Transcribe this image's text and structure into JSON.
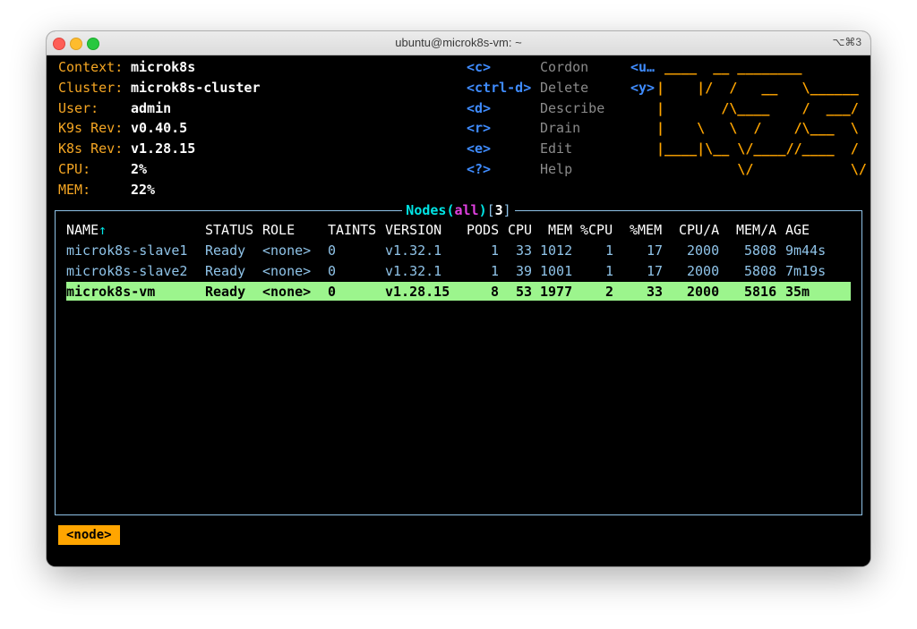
{
  "window": {
    "title": "ubuntu@microk8s-vm: ~",
    "shortcut": "⌥⌘3"
  },
  "info": [
    {
      "key": "Context:",
      "value": "microk8s"
    },
    {
      "key": "Cluster:",
      "value": "microk8s-cluster"
    },
    {
      "key": "User:",
      "value": "admin"
    },
    {
      "key": "K9s Rev:",
      "value": "v0.40.5"
    },
    {
      "key": "K8s Rev:",
      "value": "v1.28.15"
    },
    {
      "key": "CPU:",
      "value": "2%"
    },
    {
      "key": "MEM:",
      "value": "22%"
    }
  ],
  "hotkeys": [
    {
      "key": "<c>",
      "action": "Cordon"
    },
    {
      "key": "<ctrl-d>",
      "action": "Delete"
    },
    {
      "key": "<d>",
      "action": "Describe"
    },
    {
      "key": "<r>",
      "action": "Drain"
    },
    {
      "key": "<e>",
      "action": "Edit"
    },
    {
      "key": "<?>",
      "action": "Help"
    }
  ],
  "hotkeys2": [
    "<u…",
    "<y>"
  ],
  "logo": [
    " ____  __ ________",
    "|    |/  /   __   \\______",
    "|       /\\____    /  ___/",
    "|    \\   \\  /    /\\___  \\",
    "|____|\\__ \\/____//____  /",
    "          \\/            \\/"
  ],
  "table": {
    "title": {
      "resource": "Nodes",
      "paren_open": "(",
      "ns": "all",
      "paren_close": ")",
      "bracket_open": "[",
      "count": "3",
      "bracket_close": "]"
    },
    "sort_indicator": "↑",
    "columns": [
      "NAME",
      "STATUS",
      "ROLE",
      "TAINTS",
      "VERSION",
      "PODS",
      "CPU",
      "MEM",
      "%CPU",
      "%MEM",
      "CPU/A",
      "MEM/A",
      "AGE"
    ],
    "rows": [
      [
        "microk8s-slave1",
        "Ready",
        "<none>",
        "0",
        "v1.32.1",
        "1",
        "33",
        "1012",
        "1",
        "17",
        "2000",
        "5808",
        "9m44s"
      ],
      [
        "microk8s-slave2",
        "Ready",
        "<none>",
        "0",
        "v1.32.1",
        "1",
        "39",
        "1001",
        "1",
        "17",
        "2000",
        "5808",
        "7m19s"
      ],
      [
        "microk8s-vm",
        "Ready",
        "<none>",
        "0",
        "v1.28.15",
        "8",
        "53",
        "1977",
        "2",
        "33",
        "2000",
        "5816",
        "35m"
      ]
    ],
    "selected_row": 2
  },
  "breadcrumb": "<node>",
  "colors": {
    "info_key": "#f5a623",
    "hotkey": "#3f8cff",
    "hotkey_action": "#8a8a8a",
    "logo": "#ffa500",
    "frame": "#8fc3e8",
    "row_text": "#8fc3e8",
    "selected_row_bg": "#9cf58d",
    "breadcrumb_bg": "#ffa500"
  }
}
